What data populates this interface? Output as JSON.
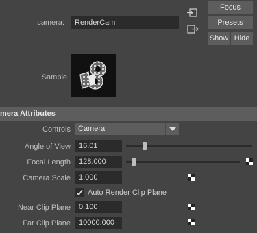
{
  "camera_field": {
    "label": "camera:",
    "value": "RenderCam"
  },
  "buttons": {
    "focus": "Focus",
    "presets": "Presets",
    "show": "Show",
    "hide": "Hide"
  },
  "sample": {
    "label": "Sample"
  },
  "section": {
    "title": "mera Attributes"
  },
  "controls": {
    "label": "Controls",
    "value": "Camera"
  },
  "angle_of_view": {
    "label": "Angle of View",
    "value": "16.01",
    "slider_fraction": 0.13
  },
  "focal_length": {
    "label": "Focal Length",
    "value": "128.000",
    "slider_fraction": 0.05
  },
  "camera_scale": {
    "label": "Camera Scale",
    "value": "1.000"
  },
  "auto_render_clip": {
    "label": "Auto Render Clip Plane",
    "checked": true
  },
  "near_clip": {
    "label": "Near Clip Plane",
    "value": "0.100"
  },
  "far_clip": {
    "label": "Far Clip Plane",
    "value": "10000.000"
  },
  "icons": [
    "input-connection-icon",
    "output-connection-icon",
    "dropdown-arrow-icon",
    "keyframe-icon",
    "checkbox-check-icon"
  ]
}
